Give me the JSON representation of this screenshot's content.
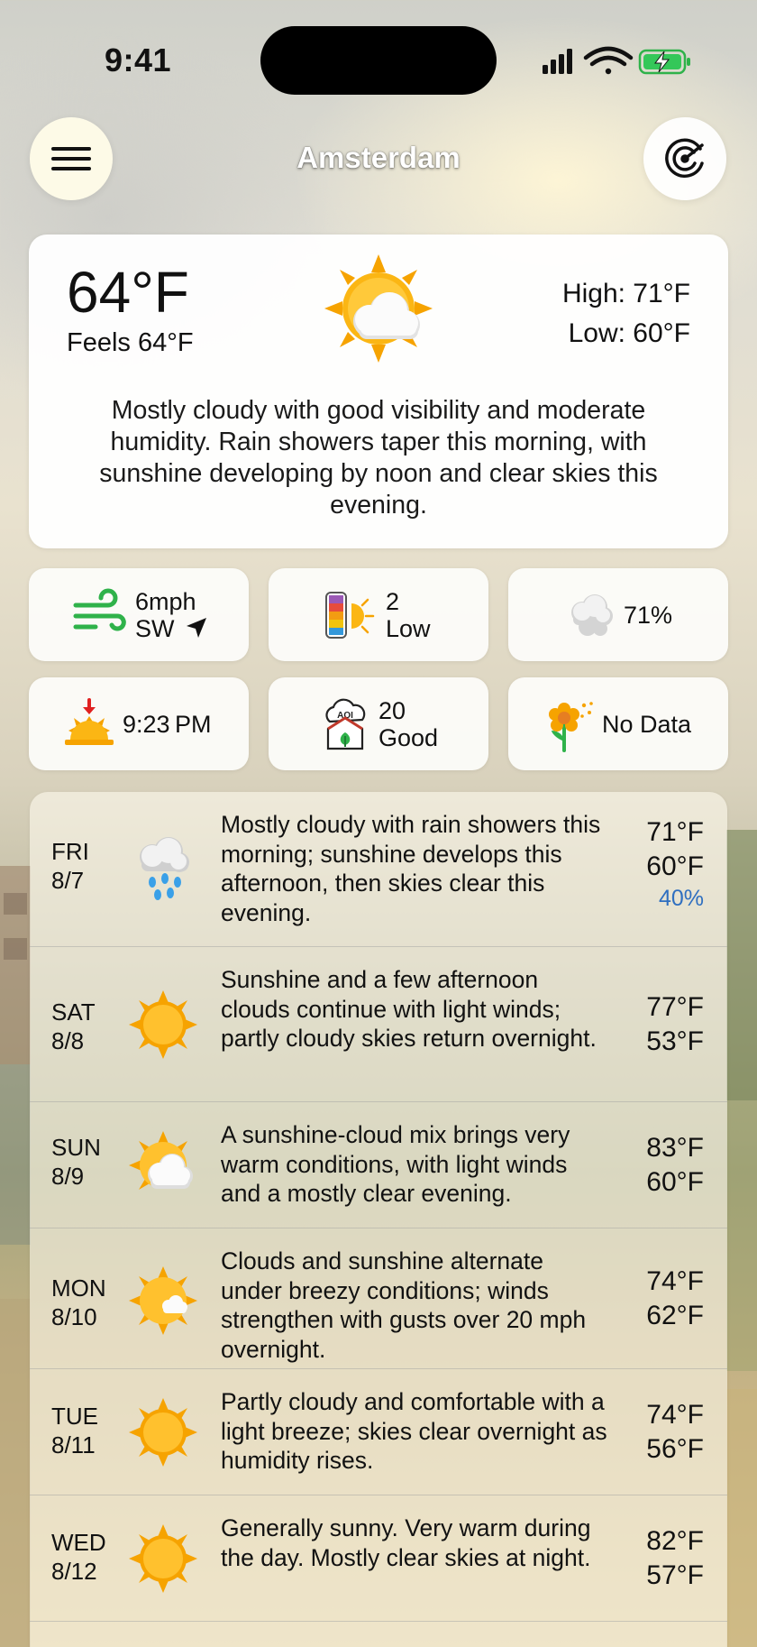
{
  "status": {
    "time": "9:41"
  },
  "header": {
    "city": "Amsterdam",
    "menu_icon": "hamburger-icon",
    "radar_icon": "radar-icon"
  },
  "current": {
    "temp": "64°F",
    "feels": "Feels 64°F",
    "high": "High: 71°F",
    "low": "Low: 60°F",
    "icon": "sun-cloud-icon",
    "summary": "Mostly cloudy with good visibility and moderate humidity. Rain showers taper this morning, with sunshine developing by noon and clear skies this evening."
  },
  "tiles": {
    "wind": {
      "speed": "6mph",
      "dir": "SW",
      "icon": "wind-icon",
      "arrow_icon": "direction-arrow-icon",
      "color": "#2fb24a"
    },
    "uv": {
      "value": "2",
      "label": "Low",
      "icon": "uv-index-icon"
    },
    "humidity": {
      "value": "71%",
      "icon": "cloud-humidity-icon"
    },
    "sunset": {
      "value": "9:23 PM",
      "icon": "sunset-icon"
    },
    "aqi": {
      "value": "20",
      "label": "Good",
      "icon": "aqi-icon"
    },
    "pollen": {
      "value": "No Data",
      "icon": "pollen-flower-icon"
    }
  },
  "forecast": [
    {
      "dow": "FRI",
      "date": "8/7",
      "icon": "rain-cloud-icon",
      "desc": "Mostly cloudy with rain showers this morning; sunshine develops this afternoon, then skies clear this evening.",
      "high": "71°F",
      "low": "60°F",
      "pop": "40%"
    },
    {
      "dow": "SAT",
      "date": "8/8",
      "icon": "sun-icon",
      "desc": "Sunshine and a few afternoon clouds continue with light winds; partly cloudy skies return overnight.",
      "high": "77°F",
      "low": "53°F",
      "pop": ""
    },
    {
      "dow": "SUN",
      "date": "8/9",
      "icon": "sun-cloud-icon",
      "desc": "A sunshine-cloud mix brings very warm conditions, with light winds and a mostly clear evening.",
      "high": "83°F",
      "low": "60°F",
      "pop": ""
    },
    {
      "dow": "MON",
      "date": "8/10",
      "icon": "sun-small-cloud-icon",
      "desc": "Clouds and sunshine alternate under breezy conditions; winds strengthen with gusts over 20 mph overnight.",
      "high": "74°F",
      "low": "62°F",
      "pop": ""
    },
    {
      "dow": "TUE",
      "date": "8/11",
      "icon": "sun-icon",
      "desc": "Partly cloudy and comfortable with a light breeze; skies clear overnight as humidity rises.",
      "high": "74°F",
      "low": "56°F",
      "pop": ""
    },
    {
      "dow": "WED",
      "date": "8/12",
      "icon": "sun-icon",
      "desc": "Generally sunny. Very warm during the day. Mostly clear skies at night.",
      "high": "82°F",
      "low": "57°F",
      "pop": ""
    }
  ]
}
